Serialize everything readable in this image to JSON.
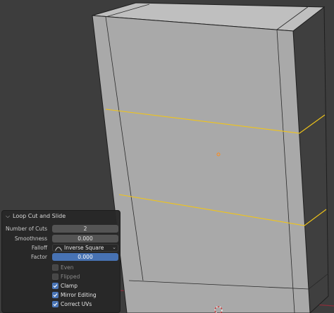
{
  "panel": {
    "title": "Loop Cut and Slide",
    "number_of_cuts": {
      "label": "Number of Cuts",
      "value": "2"
    },
    "smoothness": {
      "label": "Smoothness",
      "value": "0.000"
    },
    "falloff": {
      "label": "Falloff",
      "value": "Inverse Square",
      "icon": "inverse-square-falloff-icon"
    },
    "factor": {
      "label": "Factor",
      "value": "0.000"
    },
    "options": [
      {
        "label": "Even",
        "checked": false,
        "enabled": false
      },
      {
        "label": "Flipped",
        "checked": false,
        "enabled": false
      },
      {
        "label": "Clamp",
        "checked": true,
        "enabled": true
      },
      {
        "label": "Mirror Editing",
        "checked": true,
        "enabled": true
      },
      {
        "label": "Correct UVs",
        "checked": true,
        "enabled": true
      }
    ]
  },
  "colors": {
    "viewport_bg": "#3d3d3d",
    "mesh_front": "#a9a9a9",
    "mesh_top": "#bfbfbf",
    "mesh_side": "#3f3f3f",
    "edge": "#1e1e1e",
    "loop_cut": "#f0c419",
    "origin": "#ff8c1a",
    "accent": "#4772b3",
    "x_axis": "#8b2d39"
  }
}
